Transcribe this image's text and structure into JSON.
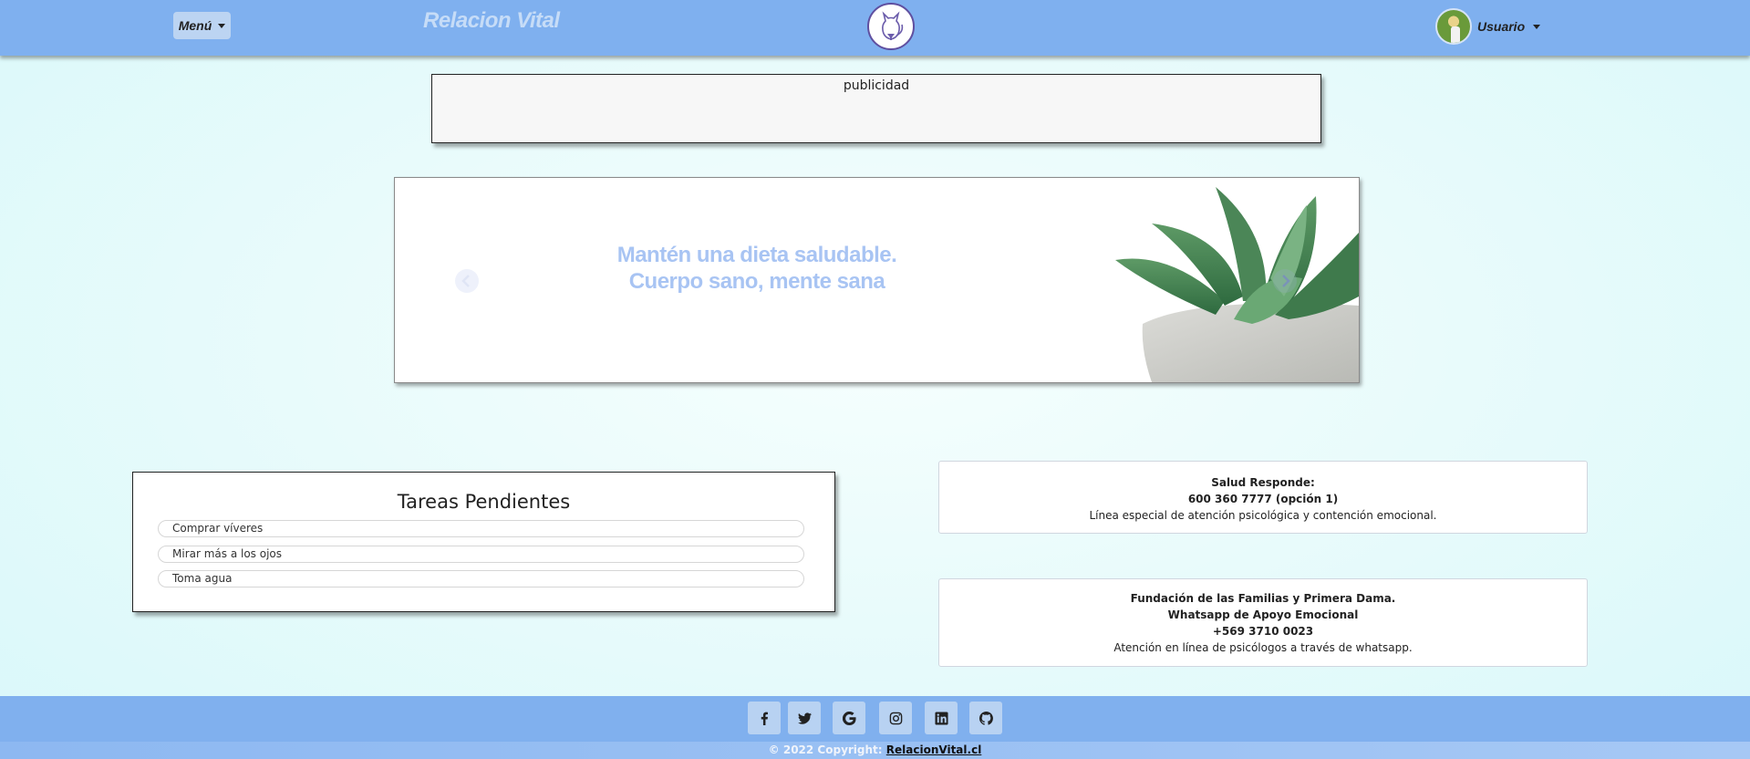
{
  "navbar": {
    "menu_label": "Menú",
    "brand": "Relacion Vital",
    "user_label": "Usuario",
    "bg_color": "#7fb0ef"
  },
  "ad": {
    "label": "publicidad"
  },
  "carousel": {
    "caption_line1": "Mantén una dieta saludable.",
    "caption_line2": "Cuerpo sano, mente sana"
  },
  "tasks": {
    "title": "Tareas Pendientes",
    "items": [
      "Comprar víveres",
      "Mirar más a los ojos",
      "Toma agua"
    ]
  },
  "cards": [
    {
      "title": "Salud Responde:",
      "phone": "600 360 7777 (opción 1)",
      "description": "Línea especial de atención psicológica y contención emocional."
    },
    {
      "title": "Fundación de las Familias y Primera Dama.",
      "subtitle": "Whatsapp de Apoyo Emocional",
      "phone": "+569 3710 0023",
      "description": "Atención en línea de psicólogos a través de whatsapp."
    }
  ],
  "footer": {
    "social_icons": [
      "facebook-icon",
      "twitter-icon",
      "google-icon",
      "instagram-icon",
      "linkedin-icon",
      "github-icon"
    ],
    "copyright_prefix": "© 2022 Copyright:",
    "copyright_link": "RelacionVital.cl"
  }
}
